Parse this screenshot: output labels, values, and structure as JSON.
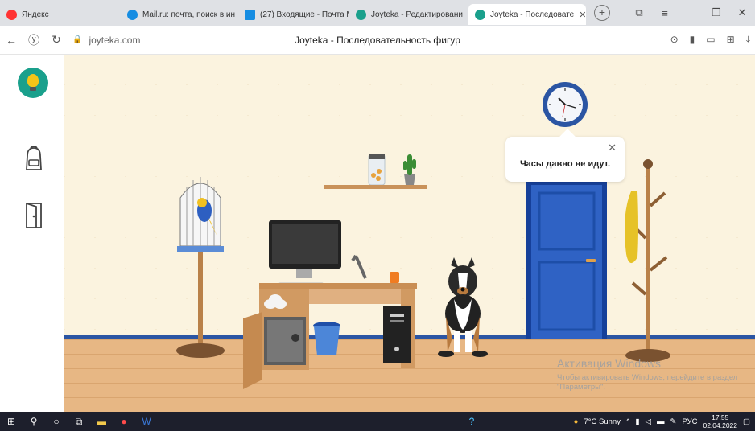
{
  "browser": {
    "tabs": [
      {
        "label": "Яндекс",
        "icon": "yandex-icon",
        "color": "#ff3333"
      },
      {
        "label": "Mail.ru: почта, поиск в ин",
        "icon": "mailru-icon",
        "color": "#168de2"
      },
      {
        "label": "(27) Входящие - Почта М",
        "icon": "mail-icon",
        "color": "#168de2"
      },
      {
        "label": "Joyteka - Редактировани",
        "icon": "joyteka-icon",
        "color": "#1aa08c"
      },
      {
        "label": "Joyteka - Последовате",
        "icon": "joyteka-icon",
        "color": "#1aa08c",
        "active": true
      }
    ],
    "url": "joyteka.com",
    "page_title": "Joyteka - Последовательность фигур"
  },
  "scene": {
    "bubble_text": "Часы давно не идут.",
    "accent": "#2b55a3",
    "door_color": "#1f4fa8"
  },
  "watermark": {
    "title": "Активация Windows",
    "subtitle": "Чтобы активировать Windows, перейдите в раздел \"Параметры\"."
  },
  "taskbar": {
    "weather": "7°C  Sunny",
    "lang": "РУС",
    "time": "17:55",
    "date": "02.04.2022"
  }
}
